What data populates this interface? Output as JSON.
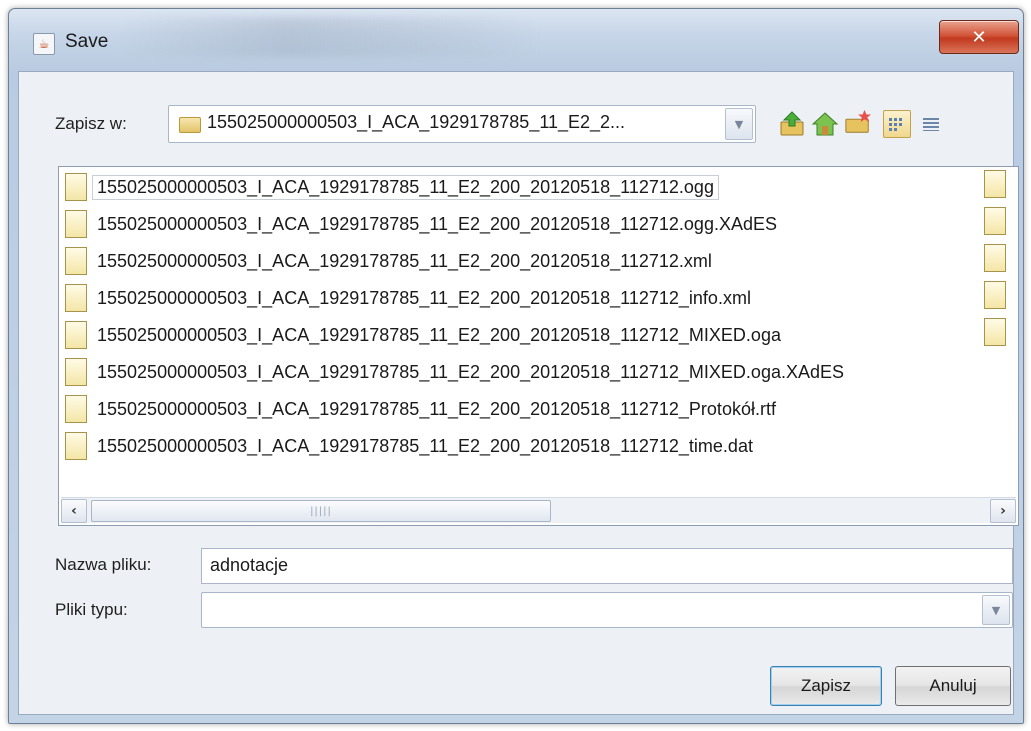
{
  "window": {
    "title": "Save",
    "close_glyph": "✕"
  },
  "toolbar": {
    "save_in_label": "Zapisz w:",
    "current_folder": "155025000000503_I_ACA_1929178785_11_E2_2...",
    "icons": [
      "up-folder-icon",
      "home-icon",
      "new-folder-icon",
      "list-view-icon",
      "details-view-icon"
    ]
  },
  "files": [
    {
      "name": "155025000000503_I_ACA_1929178785_11_E2_200_20120518_112712.ogg"
    },
    {
      "name": "155025000000503_I_ACA_1929178785_11_E2_200_20120518_112712.ogg.XAdES"
    },
    {
      "name": "155025000000503_I_ACA_1929178785_11_E2_200_20120518_112712.xml"
    },
    {
      "name": "155025000000503_I_ACA_1929178785_11_E2_200_20120518_112712_info.xml"
    },
    {
      "name": "155025000000503_I_ACA_1929178785_11_E2_200_20120518_112712_MIXED.oga"
    },
    {
      "name": "155025000000503_I_ACA_1929178785_11_E2_200_20120518_112712_MIXED.oga.XAdES"
    },
    {
      "name": "155025000000503_I_ACA_1929178785_11_E2_200_20120518_112712_Protokół.rtf"
    },
    {
      "name": "155025000000503_I_ACA_1929178785_11_E2_200_20120518_112712_time.dat"
    }
  ],
  "form": {
    "filename_label": "Nazwa pliku:",
    "filename_value": "adnotacje",
    "filetype_label": "Pliki typu:",
    "filetype_value": ""
  },
  "buttons": {
    "save": "Zapisz",
    "cancel": "Anuluj"
  }
}
